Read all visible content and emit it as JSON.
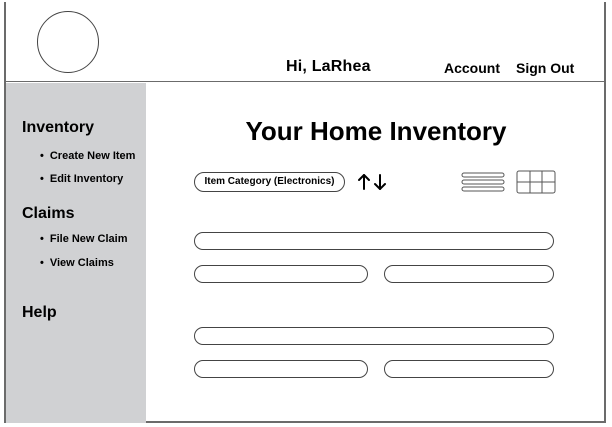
{
  "header": {
    "greeting": "Hi, LaRhea",
    "account_label": "Account",
    "signout_label": "Sign Out"
  },
  "sidebar": {
    "sections": [
      {
        "label": "Inventory",
        "items": [
          "Create New Item",
          "Edit Inventory"
        ]
      },
      {
        "label": "Claims",
        "items": [
          "File New Claim",
          "View Claims"
        ]
      },
      {
        "label": "Help",
        "items": []
      }
    ]
  },
  "main": {
    "title": "Your Home Inventory",
    "category_filter": "Item Category (Electronics)",
    "icons": [
      "sort-up-down-icon",
      "list-view-icon",
      "grid-view-icon"
    ]
  },
  "colors": {
    "sidebar_bg": "#d0d1d3",
    "border": "#6b6b6b"
  }
}
